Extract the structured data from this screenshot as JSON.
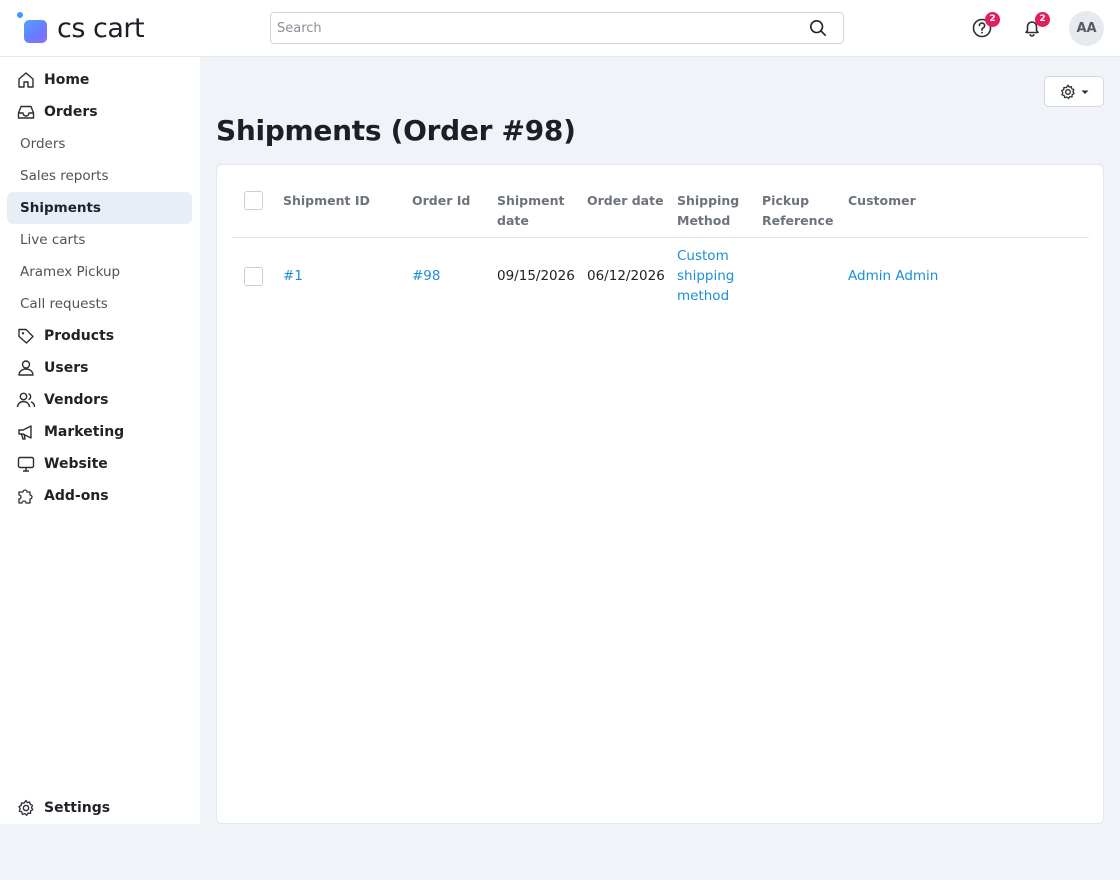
{
  "brand": {
    "logo_text": "cs cart"
  },
  "search": {
    "placeholder": "Search"
  },
  "header": {
    "help_badge": "2",
    "notifications_badge": "2",
    "avatar_initials": "AA"
  },
  "sidebar": {
    "items": [
      {
        "label": "Home",
        "icon": "home-icon",
        "level": "top"
      },
      {
        "label": "Orders",
        "icon": "inbox-icon",
        "level": "top"
      },
      {
        "label": "Orders",
        "level": "sub"
      },
      {
        "label": "Sales reports",
        "level": "sub"
      },
      {
        "label": "Shipments",
        "level": "sub",
        "active": true
      },
      {
        "label": "Live carts",
        "level": "sub"
      },
      {
        "label": "Aramex Pickup",
        "level": "sub"
      },
      {
        "label": "Call requests",
        "level": "sub"
      },
      {
        "label": "Products",
        "icon": "tag-icon",
        "level": "top"
      },
      {
        "label": "Users",
        "icon": "user-icon",
        "level": "top"
      },
      {
        "label": "Vendors",
        "icon": "users-icon",
        "level": "top"
      },
      {
        "label": "Marketing",
        "icon": "megaphone-icon",
        "level": "top"
      },
      {
        "label": "Website",
        "icon": "monitor-icon",
        "level": "top"
      },
      {
        "label": "Add-ons",
        "icon": "puzzle-icon",
        "level": "top"
      }
    ],
    "settings": {
      "label": "Settings",
      "icon": "gear-icon"
    }
  },
  "main": {
    "title": "Shipments (Order #98)",
    "table": {
      "columns": [
        "Shipment ID",
        "Order Id",
        "Shipment date",
        "Order date",
        "Shipping Method",
        "Pickup Reference",
        "Customer"
      ],
      "rows": [
        {
          "shipment_id": "#1",
          "order_id": "#98",
          "shipment_date": "09/15/2026",
          "order_date": "06/12/2026",
          "shipping_method": "Custom shipping method",
          "pickup_reference": "",
          "customer": "Admin Admin"
        }
      ]
    }
  },
  "colors": {
    "accent_link": "#1a8fd6",
    "badge": "#e01f5b",
    "active_nav_bg": "#e9edf5"
  }
}
